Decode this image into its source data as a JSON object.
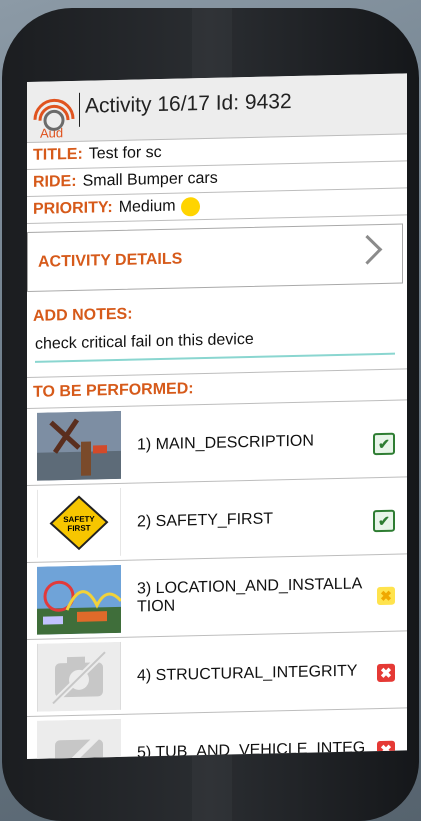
{
  "header": {
    "title": "Activity 16/17 Id: 9432",
    "logo_text": "Aud"
  },
  "fields": {
    "title_label": "TITLE:",
    "title_value": "Test for sc",
    "ride_label": "RIDE:",
    "ride_value": "Small Bumper cars",
    "priority_label": "PRIORITY:",
    "priority_value": "Medium",
    "priority_color": "#ffd400"
  },
  "activity_details": "ACTIVITY DETAILS",
  "notes": {
    "label": "ADD NOTES:",
    "value": "check critical fail on this device"
  },
  "to_be_performed": {
    "label": "TO BE PERFORMED:",
    "items": [
      {
        "label": "1) MAIN_DESCRIPTION",
        "status": "ok",
        "icon": "check-icon"
      },
      {
        "label": "2) SAFETY_FIRST",
        "status": "ok",
        "icon": "check-icon",
        "sign_text": "SAFETY FIRST"
      },
      {
        "label": "3) LOCATION_AND_INSTALLA TION",
        "status": "warn",
        "icon": "x-icon"
      },
      {
        "label": "4) STRUCTURAL_INTEGRITY",
        "status": "fail",
        "icon": "x-icon"
      },
      {
        "label": "5) TUB_AND_VEHICLE_INTEG",
        "status": "fail",
        "icon": "x-icon"
      }
    ]
  },
  "colors": {
    "accent": "#d65a1a",
    "ok": "#2e7d32",
    "warn": "#ffe34d",
    "fail": "#e53935"
  }
}
